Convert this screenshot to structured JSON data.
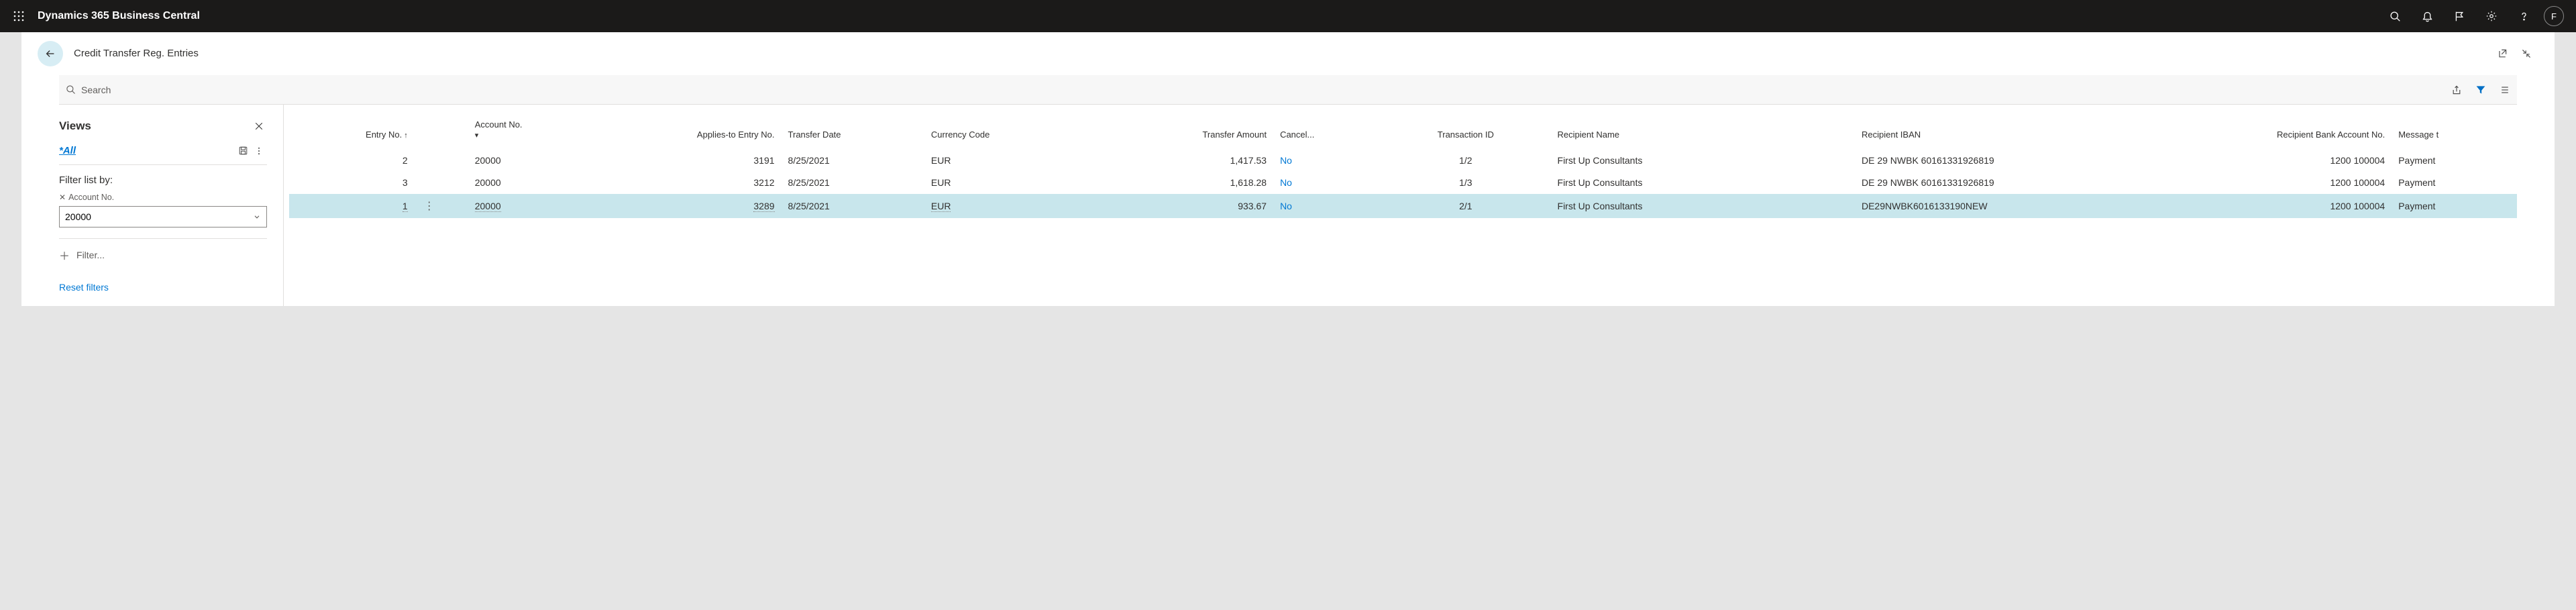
{
  "topbar": {
    "title": "Dynamics 365 Business Central",
    "avatar_initial": "F"
  },
  "page": {
    "title": "Credit Transfer Reg. Entries"
  },
  "toolbar": {
    "search_label": "Search"
  },
  "views": {
    "title": "Views",
    "all_label": "*All",
    "filter_by_label": "Filter list by:",
    "filter_field_label": "Account No.",
    "filter_value": "20000",
    "add_filter_label": "Filter...",
    "reset_label": "Reset filters"
  },
  "table": {
    "columns": {
      "entry_no": "Entry No.",
      "account_no": "Account No.",
      "applies_to": "Applies-to Entry No.",
      "transfer_date": "Transfer Date",
      "currency": "Currency Code",
      "transfer_amount": "Transfer Amount",
      "cancel": "Cancel...",
      "transaction_id": "Transaction ID",
      "recipient_name": "Recipient Name",
      "recipient_iban": "Recipient IBAN",
      "recipient_bank_acc": "Recipient Bank Account No.",
      "message": "Message t"
    },
    "rows": [
      {
        "entry_no": "2",
        "account_no": "20000",
        "applies_to": "3191",
        "transfer_date": "8/25/2021",
        "currency": "EUR",
        "transfer_amount": "1,417.53",
        "cancel": "No",
        "transaction_id": "1/2",
        "recipient_name": "First Up Consultants",
        "recipient_iban": "DE 29 NWBK 60161331926819",
        "recipient_bank_acc": "1200 100004",
        "message": "Payment"
      },
      {
        "entry_no": "3",
        "account_no": "20000",
        "applies_to": "3212",
        "transfer_date": "8/25/2021",
        "currency": "EUR",
        "transfer_amount": "1,618.28",
        "cancel": "No",
        "transaction_id": "1/3",
        "recipient_name": "First Up Consultants",
        "recipient_iban": "DE 29 NWBK 60161331926819",
        "recipient_bank_acc": "1200 100004",
        "message": "Payment"
      },
      {
        "entry_no": "1",
        "account_no": "20000",
        "applies_to": "3289",
        "transfer_date": "8/25/2021",
        "currency": "EUR",
        "transfer_amount": "933.67",
        "cancel": "No",
        "transaction_id": "2/1",
        "recipient_name": "First Up Consultants",
        "recipient_iban": "DE29NWBK6016133190NEW",
        "recipient_bank_acc": "1200 100004",
        "message": "Payment"
      }
    ],
    "selected_index": 2
  }
}
